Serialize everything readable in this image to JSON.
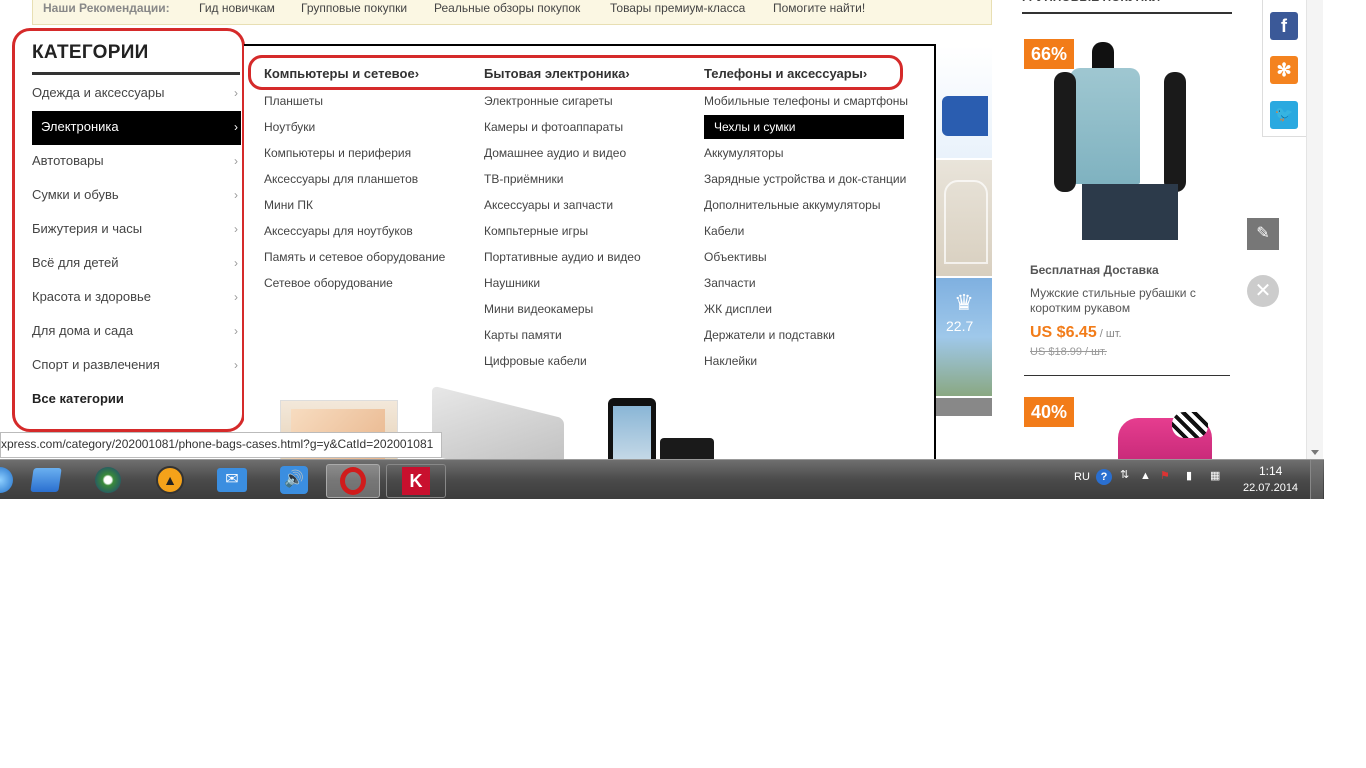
{
  "recommendations": {
    "label": "Наши Рекомендации:",
    "links": [
      "Гид новичкам",
      "Групповые покупки",
      "Реальные обзоры покупок",
      "Товары премиум-класса",
      "Помогите найти!"
    ]
  },
  "categories": {
    "title": "КАТЕГОРИИ",
    "items": [
      "Одежда и аксессуары",
      "Электроника",
      "Автотовары",
      "Сумки и обувь",
      "Бижутерия и часы",
      "Всё для детей",
      "Красота и здоровье",
      "Для дома и сада",
      "Спорт и развлечения"
    ],
    "all_label": "Все категории",
    "active_index": 1
  },
  "flyout": {
    "columns": [
      {
        "heading": "Компьютеры и сетевое",
        "items": [
          "Планшеты",
          "Ноутбуки",
          "Компьютеры и периферия",
          "Аксессуары для планшетов",
          "Мини ПК",
          "Аксессуары для ноутбуков",
          "Память и сетевое оборудование",
          "Сетевое оборудование"
        ]
      },
      {
        "heading": "Бытовая электроника",
        "items": [
          "Электронные сигареты",
          "Камеры и фотоаппараты",
          "Домашнее аудио и видео",
          "ТВ-приёмники",
          "Аксессуары и запчасти",
          "Компьтерные игры",
          "Портативные аудио и видео",
          "Наушники",
          "Мини видеокамеры",
          "Карты памяти",
          "Цифровые кабели"
        ]
      },
      {
        "heading": "Телефоны и аксессуары",
        "items": [
          "Мобильные телефоны и смартфоны",
          "Чехлы и сумки",
          "Аккумуляторы",
          "Зарядные устройства и док-станции",
          "Дополнительные аккумуляторы",
          "Кабели",
          "Объективы",
          "Запчасти",
          "ЖК дисплеи",
          "Держатели и подставки",
          "Наклейки"
        ]
      }
    ],
    "chevron": "›"
  },
  "banner": {
    "rating": "22.7"
  },
  "right_column": {
    "title": "ГРУППОВЫЕ ПОКУПКИ ›",
    "product1": {
      "discount": "66%",
      "shipping": "Бесплатная Доставка",
      "name": "Мужские стильные рубашки с коротким рукавом",
      "price": "US $6.45",
      "unit": " / шт.",
      "old_price": "US $18.99 / шт."
    },
    "product2": {
      "discount": "40%"
    }
  },
  "status_url": "xpress.com/category/202001081/phone-bags-cases.html?g=y&CatId=202001081",
  "taskbar": {
    "language": "RU",
    "time": "1:14",
    "date": "22.07.2014"
  },
  "colors": {
    "accent": "#f27c19",
    "highlight": "#d52a2a",
    "active_bg": "#000000"
  }
}
